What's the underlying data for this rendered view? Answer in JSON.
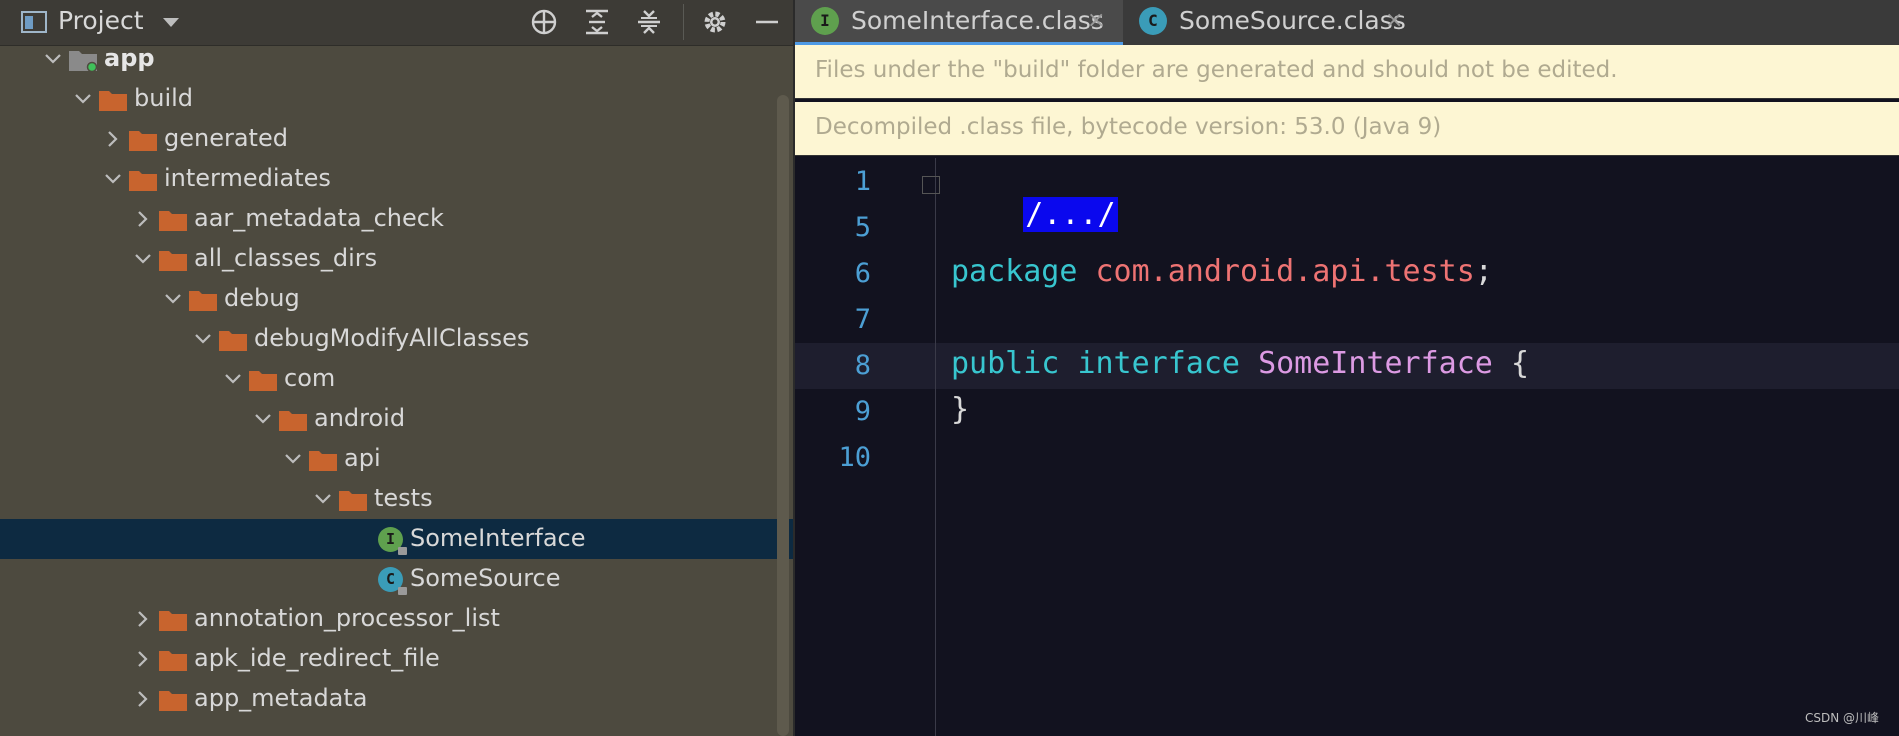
{
  "project_panel": {
    "title": "Project",
    "toolbar_icons": [
      "select-opened-file-icon",
      "expand-all-icon",
      "collapse-all-icon",
      "gear-icon",
      "minimize-icon"
    ],
    "tree": [
      {
        "label": "app",
        "level": 0,
        "expanded": true,
        "kind": "module",
        "bold": true
      },
      {
        "label": "build",
        "level": 1,
        "expanded": true,
        "kind": "folder"
      },
      {
        "label": "generated",
        "level": 2,
        "expanded": false,
        "kind": "folder"
      },
      {
        "label": "intermediates",
        "level": 2,
        "expanded": true,
        "kind": "folder"
      },
      {
        "label": "aar_metadata_check",
        "level": 3,
        "expanded": false,
        "kind": "folder"
      },
      {
        "label": "all_classes_dirs",
        "level": 3,
        "expanded": true,
        "kind": "folder"
      },
      {
        "label": "debug",
        "level": 4,
        "expanded": true,
        "kind": "folder"
      },
      {
        "label": "debugModifyAllClasses",
        "level": 5,
        "expanded": true,
        "kind": "folder"
      },
      {
        "label": "com",
        "level": 6,
        "expanded": true,
        "kind": "folder"
      },
      {
        "label": "android",
        "level": 7,
        "expanded": true,
        "kind": "folder"
      },
      {
        "label": "api",
        "level": 8,
        "expanded": true,
        "kind": "folder"
      },
      {
        "label": "tests",
        "level": 9,
        "expanded": true,
        "kind": "folder"
      },
      {
        "label": "SomeInterface",
        "level": 11,
        "kind": "interface",
        "icon_letter": "I",
        "selected": true
      },
      {
        "label": "SomeSource",
        "level": 11,
        "kind": "class",
        "icon_letter": "C"
      },
      {
        "label": "annotation_processor_list",
        "level": 3,
        "expanded": false,
        "kind": "folder"
      },
      {
        "label": "apk_ide_redirect_file",
        "level": 3,
        "expanded": false,
        "kind": "folder"
      },
      {
        "label": "app_metadata",
        "level": 3,
        "expanded": false,
        "kind": "folder"
      }
    ]
  },
  "editor": {
    "tabs": [
      {
        "label": "SomeInterface.class",
        "icon_letter": "I",
        "icon_color": "#5fa04e",
        "active": true,
        "close": "×"
      },
      {
        "label": "SomeSource.class",
        "icon_letter": "C",
        "icon_color": "#3a9cb8",
        "active": false,
        "close": "×"
      }
    ],
    "banners": [
      "Files under the \"build\" folder are generated and should not be edited.",
      "Decompiled .class file, bytecode version: 53.0 (Java 9)"
    ],
    "line_numbers": [
      "1",
      "5",
      "6",
      "7",
      "8",
      "9",
      "10"
    ],
    "code": {
      "fold": "/.../",
      "package_kw": "package",
      "package_name": "com.android.api.tests",
      "semicolon": ";",
      "public_kw": "public",
      "interface_kw": "interface",
      "class_name": "SomeInterface",
      "open_brace": "{",
      "close_brace": "}"
    }
  },
  "watermark": "CSDN @川峰",
  "colors": {
    "keyword": "#38c6cf",
    "package": "#ee7373",
    "class_name": "#dc9ae3",
    "folder": "#c8642e",
    "line_number": "#4c9fd4"
  }
}
